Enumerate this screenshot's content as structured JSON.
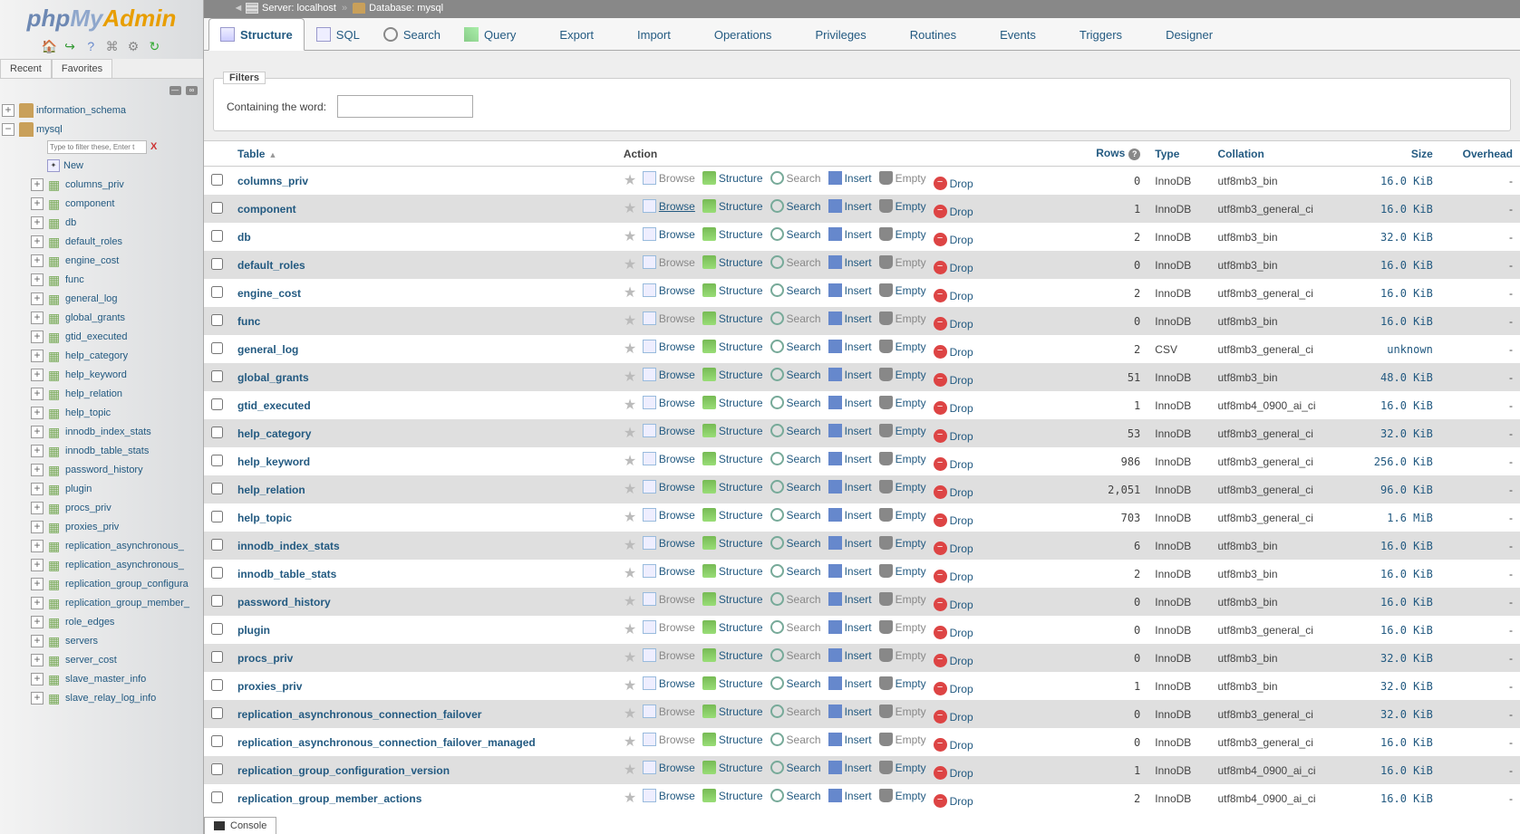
{
  "logo_parts": {
    "a": "php",
    "b": "My",
    "c": "Admin"
  },
  "sidebar_tabs": {
    "recent": "Recent",
    "favorites": "Favorites"
  },
  "breadcrumb": {
    "server_label": "Server:",
    "server": "localhost",
    "db_label": "Database:",
    "db": "mysql"
  },
  "tabs": [
    {
      "label": "Structure",
      "active": true,
      "icon": "ti-struct"
    },
    {
      "label": "SQL",
      "icon": "ti-sql"
    },
    {
      "label": "Search",
      "icon": "ti-search"
    },
    {
      "label": "Query",
      "icon": "ti-query"
    },
    {
      "label": "Export",
      "icon": "ti-export"
    },
    {
      "label": "Import",
      "icon": "ti-import"
    },
    {
      "label": "Operations",
      "icon": "ti-ops"
    },
    {
      "label": "Privileges",
      "icon": "ti-priv"
    },
    {
      "label": "Routines",
      "icon": "ti-rout"
    },
    {
      "label": "Events",
      "icon": "ti-event"
    },
    {
      "label": "Triggers",
      "icon": "ti-trig"
    },
    {
      "label": "Designer",
      "icon": "ti-des"
    }
  ],
  "filters": {
    "legend": "Filters",
    "label": "Containing the word:"
  },
  "headers": {
    "table": "Table",
    "action": "Action",
    "rows": "Rows",
    "type": "Type",
    "collation": "Collation",
    "size": "Size",
    "overhead": "Overhead"
  },
  "action_labels": {
    "browse": "Browse",
    "structure": "Structure",
    "search": "Search",
    "insert": "Insert",
    "empty": "Empty",
    "drop": "Drop"
  },
  "tree": {
    "filter_placeholder": "Type to filter these, Enter t",
    "new_label": "New",
    "databases": [
      {
        "name": "information_schema",
        "expanded": false
      },
      {
        "name": "mysql",
        "expanded": true
      }
    ],
    "mysql_tables": [
      "columns_priv",
      "component",
      "db",
      "default_roles",
      "engine_cost",
      "func",
      "general_log",
      "global_grants",
      "gtid_executed",
      "help_category",
      "help_keyword",
      "help_relation",
      "help_topic",
      "innodb_index_stats",
      "innodb_table_stats",
      "password_history",
      "plugin",
      "procs_priv",
      "proxies_priv",
      "replication_asynchronous_",
      "replication_asynchronous_",
      "replication_group_configura",
      "replication_group_member_",
      "role_edges",
      "servers",
      "server_cost",
      "slave_master_info",
      "slave_relay_log_info"
    ]
  },
  "rows": [
    {
      "name": "columns_priv",
      "rows": "0",
      "type": "InnoDB",
      "collation": "utf8mb3_bin",
      "size": "16.0 KiB",
      "overhead": "-",
      "disabled": true
    },
    {
      "name": "component",
      "rows": "1",
      "type": "InnoDB",
      "collation": "utf8mb3_general_ci",
      "size": "16.0 KiB",
      "overhead": "-",
      "hover": true
    },
    {
      "name": "db",
      "rows": "2",
      "type": "InnoDB",
      "collation": "utf8mb3_bin",
      "size": "32.0 KiB",
      "overhead": "-"
    },
    {
      "name": "default_roles",
      "rows": "0",
      "type": "InnoDB",
      "collation": "utf8mb3_bin",
      "size": "16.0 KiB",
      "overhead": "-",
      "disabled": true
    },
    {
      "name": "engine_cost",
      "rows": "2",
      "type": "InnoDB",
      "collation": "utf8mb3_general_ci",
      "size": "16.0 KiB",
      "overhead": "-"
    },
    {
      "name": "func",
      "rows": "0",
      "type": "InnoDB",
      "collation": "utf8mb3_bin",
      "size": "16.0 KiB",
      "overhead": "-",
      "disabled": true
    },
    {
      "name": "general_log",
      "rows": "2",
      "type": "CSV",
      "collation": "utf8mb3_general_ci",
      "size": "unknown",
      "overhead": "-"
    },
    {
      "name": "global_grants",
      "rows": "51",
      "type": "InnoDB",
      "collation": "utf8mb3_bin",
      "size": "48.0 KiB",
      "overhead": "-"
    },
    {
      "name": "gtid_executed",
      "rows": "1",
      "type": "InnoDB",
      "collation": "utf8mb4_0900_ai_ci",
      "size": "16.0 KiB",
      "overhead": "-"
    },
    {
      "name": "help_category",
      "rows": "53",
      "type": "InnoDB",
      "collation": "utf8mb3_general_ci",
      "size": "32.0 KiB",
      "overhead": "-"
    },
    {
      "name": "help_keyword",
      "rows": "986",
      "type": "InnoDB",
      "collation": "utf8mb3_general_ci",
      "size": "256.0 KiB",
      "overhead": "-"
    },
    {
      "name": "help_relation",
      "rows": "2,051",
      "type": "InnoDB",
      "collation": "utf8mb3_general_ci",
      "size": "96.0 KiB",
      "overhead": "-"
    },
    {
      "name": "help_topic",
      "rows": "703",
      "type": "InnoDB",
      "collation": "utf8mb3_general_ci",
      "size": "1.6 MiB",
      "overhead": "-"
    },
    {
      "name": "innodb_index_stats",
      "rows": "6",
      "type": "InnoDB",
      "collation": "utf8mb3_bin",
      "size": "16.0 KiB",
      "overhead": "-"
    },
    {
      "name": "innodb_table_stats",
      "rows": "2",
      "type": "InnoDB",
      "collation": "utf8mb3_bin",
      "size": "16.0 KiB",
      "overhead": "-"
    },
    {
      "name": "password_history",
      "rows": "0",
      "type": "InnoDB",
      "collation": "utf8mb3_bin",
      "size": "16.0 KiB",
      "overhead": "-",
      "disabled": true
    },
    {
      "name": "plugin",
      "rows": "0",
      "type": "InnoDB",
      "collation": "utf8mb3_general_ci",
      "size": "16.0 KiB",
      "overhead": "-",
      "disabled": true
    },
    {
      "name": "procs_priv",
      "rows": "0",
      "type": "InnoDB",
      "collation": "utf8mb3_bin",
      "size": "32.0 KiB",
      "overhead": "-",
      "disabled": true
    },
    {
      "name": "proxies_priv",
      "rows": "1",
      "type": "InnoDB",
      "collation": "utf8mb3_bin",
      "size": "32.0 KiB",
      "overhead": "-"
    },
    {
      "name": "replication_asynchronous_connection_failover",
      "rows": "0",
      "type": "InnoDB",
      "collation": "utf8mb3_general_ci",
      "size": "32.0 KiB",
      "overhead": "-",
      "disabled": true
    },
    {
      "name": "replication_asynchronous_connection_failover_managed",
      "rows": "0",
      "type": "InnoDB",
      "collation": "utf8mb3_general_ci",
      "size": "16.0 KiB",
      "overhead": "-",
      "disabled": true
    },
    {
      "name": "replication_group_configuration_version",
      "rows": "1",
      "type": "InnoDB",
      "collation": "utf8mb4_0900_ai_ci",
      "size": "16.0 KiB",
      "overhead": "-"
    },
    {
      "name": "replication_group_member_actions",
      "rows": "2",
      "type": "InnoDB",
      "collation": "utf8mb4_0900_ai_ci",
      "size": "16.0 KiB",
      "overhead": "-"
    }
  ],
  "console_label": "Console"
}
